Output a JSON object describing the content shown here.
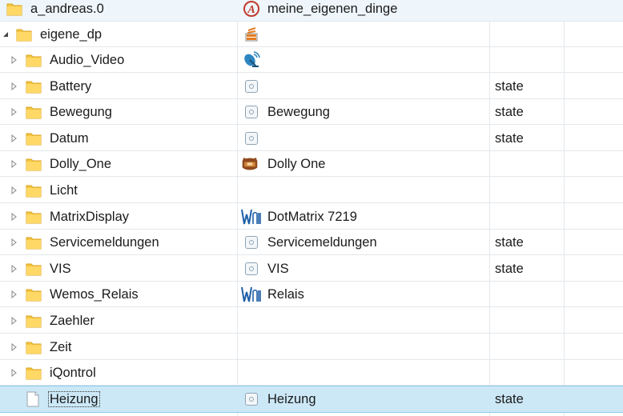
{
  "rows": [
    {
      "name": "a_andreas.0",
      "common_name": "meine_eigenen_dinge",
      "role": "",
      "icon": "adapter-a-logo-icon"
    },
    {
      "name": "eigene_dp",
      "common_name": "",
      "role": "",
      "icon": "stack-icon"
    },
    {
      "name": "Audio_Video",
      "common_name": "",
      "role": "",
      "icon": "satellite-dish-icon"
    },
    {
      "name": "Battery",
      "common_name": "",
      "role": "state",
      "icon": "state-icon"
    },
    {
      "name": "Bewegung",
      "common_name": "Bewegung",
      "role": "state",
      "icon": "state-icon"
    },
    {
      "name": "Datum",
      "common_name": "",
      "role": "state",
      "icon": "state-icon"
    },
    {
      "name": "Dolly_One",
      "common_name": "Dolly One",
      "role": "",
      "icon": "dolly-logo-icon"
    },
    {
      "name": "Licht",
      "common_name": "",
      "role": "",
      "icon": ""
    },
    {
      "name": "MatrixDisplay",
      "common_name": "DotMatrix 7219",
      "role": "",
      "icon": "wemos-logo-icon"
    },
    {
      "name": "Servicemeldungen",
      "common_name": "Servicemeldungen",
      "role": "state",
      "icon": "state-icon"
    },
    {
      "name": "VIS",
      "common_name": "VIS",
      "role": "state",
      "icon": "state-icon"
    },
    {
      "name": "Wemos_Relais",
      "common_name": "Relais",
      "role": "",
      "icon": "wemos-logo-icon"
    },
    {
      "name": "Zaehler",
      "common_name": "",
      "role": "",
      "icon": ""
    },
    {
      "name": "Zeit",
      "common_name": "",
      "role": "",
      "icon": ""
    },
    {
      "name": "iQontrol",
      "common_name": "",
      "role": "",
      "icon": ""
    },
    {
      "name": "Heizung",
      "common_name": "Heizung",
      "role": "state",
      "icon": "state-icon"
    }
  ],
  "colors": {
    "selection": "#cce8f7",
    "folder": "#f5c542",
    "wemos_blue": "#1f5fa8",
    "adapter_red": "#c0392b"
  }
}
